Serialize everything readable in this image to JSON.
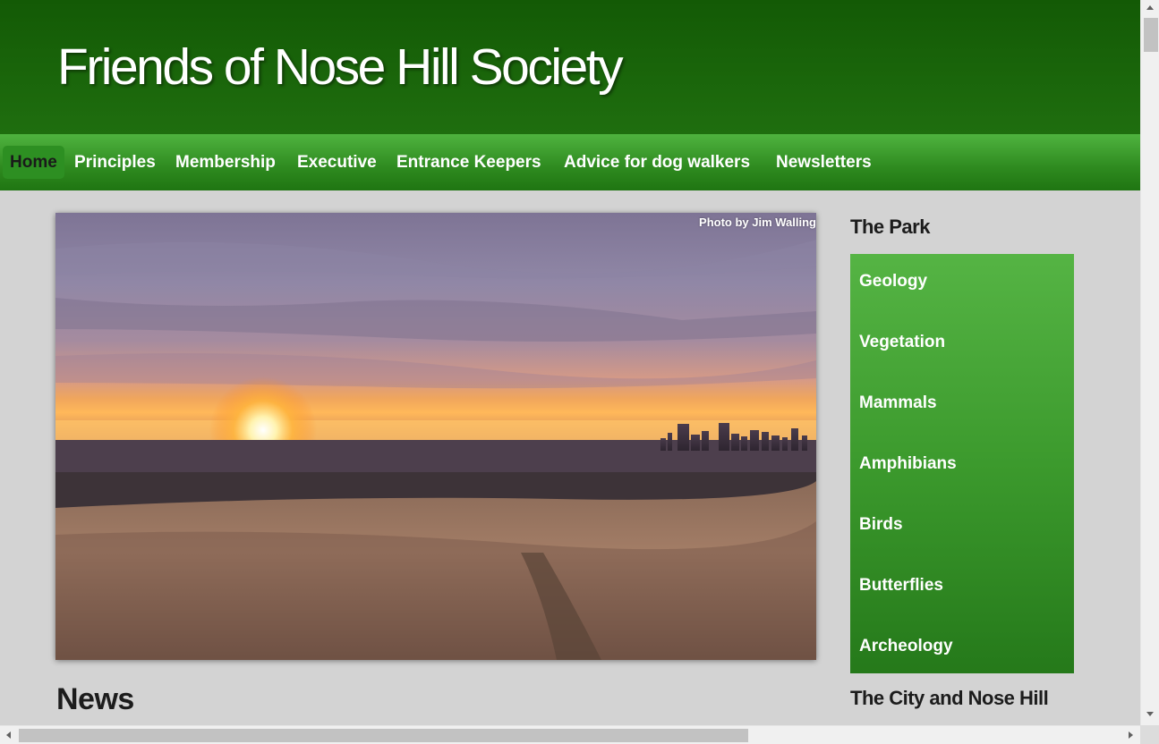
{
  "site": {
    "title": "Friends of Nose Hill Society"
  },
  "nav": {
    "items": [
      {
        "label": "Home",
        "active": true
      },
      {
        "label": "Principles"
      },
      {
        "label": "Membership"
      },
      {
        "label": "Executive"
      },
      {
        "label": "Entrance Keepers"
      },
      {
        "label": "Advice for dog walkers"
      },
      {
        "label": "Newsletters"
      }
    ]
  },
  "hero": {
    "credit": "Photo by Jim Walling"
  },
  "main": {
    "news_heading": "News"
  },
  "sidebar": {
    "park_heading": "The Park",
    "park_items": [
      "Geology",
      "Vegetation",
      "Mammals",
      "Amphibians",
      "Birds",
      "Butterflies",
      "Archeology"
    ],
    "city_heading": "The City and Nose Hill"
  },
  "colors": {
    "header_dark": "#135a05",
    "nav_green": "#2e8a1f",
    "menu_green_top": "#55b444",
    "menu_green_bottom": "#25791a",
    "page_background": "#d3d3d3"
  }
}
